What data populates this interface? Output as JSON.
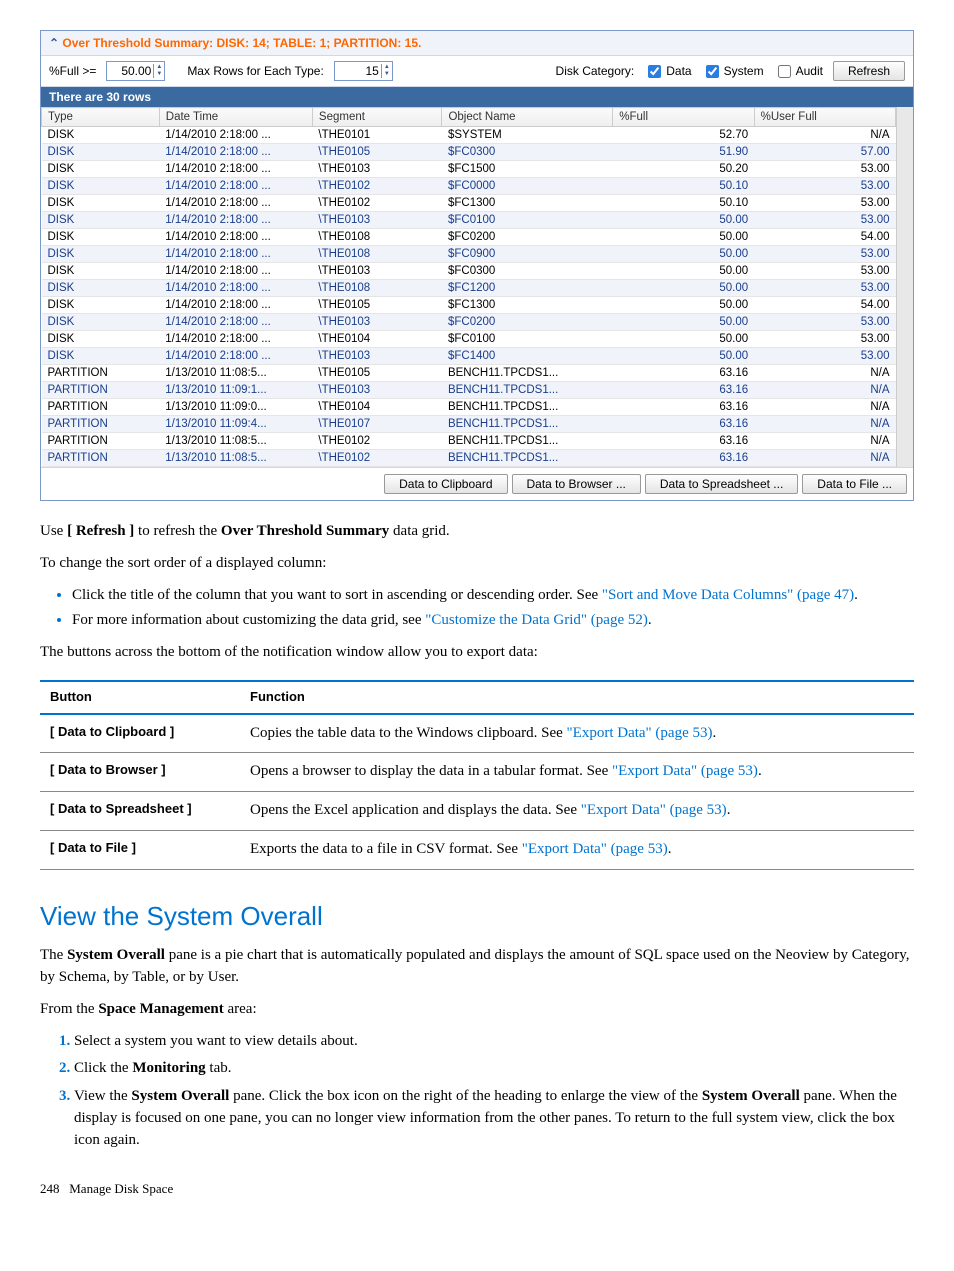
{
  "panel": {
    "title": "Over Threshold Summary: DISK: 14; TABLE: 1; PARTITION: 15.",
    "full_label": "%Full >=",
    "full_value": "50.00",
    "maxrows_label": "Max Rows for Each Type:",
    "maxrows_value": "15",
    "category_label": "Disk Category:",
    "cb_data": "Data",
    "cb_system": "System",
    "cb_audit": "Audit",
    "refresh": "Refresh",
    "rowcount": "There are 30 rows"
  },
  "columns": [
    "Type",
    "Date Time",
    "Segment",
    "Object Name",
    "%Full",
    "%User Full"
  ],
  "rows": [
    {
      "t": "DISK",
      "d": "1/14/2010 2:18:00 ...",
      "s": "\\THE0101",
      "o": "$SYSTEM",
      "f": "52.70",
      "u": "N/A",
      "alt": false
    },
    {
      "t": "DISK",
      "d": "1/14/2010 2:18:00 ...",
      "s": "\\THE0105",
      "o": "$FC0300",
      "f": "51.90",
      "u": "57.00",
      "alt": true
    },
    {
      "t": "DISK",
      "d": "1/14/2010 2:18:00 ...",
      "s": "\\THE0103",
      "o": "$FC1500",
      "f": "50.20",
      "u": "53.00",
      "alt": false
    },
    {
      "t": "DISK",
      "d": "1/14/2010 2:18:00 ...",
      "s": "\\THE0102",
      "o": "$FC0000",
      "f": "50.10",
      "u": "53.00",
      "alt": true
    },
    {
      "t": "DISK",
      "d": "1/14/2010 2:18:00 ...",
      "s": "\\THE0102",
      "o": "$FC1300",
      "f": "50.10",
      "u": "53.00",
      "alt": false
    },
    {
      "t": "DISK",
      "d": "1/14/2010 2:18:00 ...",
      "s": "\\THE0103",
      "o": "$FC0100",
      "f": "50.00",
      "u": "53.00",
      "alt": true
    },
    {
      "t": "DISK",
      "d": "1/14/2010 2:18:00 ...",
      "s": "\\THE0108",
      "o": "$FC0200",
      "f": "50.00",
      "u": "54.00",
      "alt": false
    },
    {
      "t": "DISK",
      "d": "1/14/2010 2:18:00 ...",
      "s": "\\THE0108",
      "o": "$FC0900",
      "f": "50.00",
      "u": "53.00",
      "alt": true
    },
    {
      "t": "DISK",
      "d": "1/14/2010 2:18:00 ...",
      "s": "\\THE0103",
      "o": "$FC0300",
      "f": "50.00",
      "u": "53.00",
      "alt": false
    },
    {
      "t": "DISK",
      "d": "1/14/2010 2:18:00 ...",
      "s": "\\THE0108",
      "o": "$FC1200",
      "f": "50.00",
      "u": "53.00",
      "alt": true
    },
    {
      "t": "DISK",
      "d": "1/14/2010 2:18:00 ...",
      "s": "\\THE0105",
      "o": "$FC1300",
      "f": "50.00",
      "u": "54.00",
      "alt": false
    },
    {
      "t": "DISK",
      "d": "1/14/2010 2:18:00 ...",
      "s": "\\THE0103",
      "o": "$FC0200",
      "f": "50.00",
      "u": "53.00",
      "alt": true
    },
    {
      "t": "DISK",
      "d": "1/14/2010 2:18:00 ...",
      "s": "\\THE0104",
      "o": "$FC0100",
      "f": "50.00",
      "u": "53.00",
      "alt": false
    },
    {
      "t": "DISK",
      "d": "1/14/2010 2:18:00 ...",
      "s": "\\THE0103",
      "o": "$FC1400",
      "f": "50.00",
      "u": "53.00",
      "alt": true
    },
    {
      "t": "PARTITION",
      "d": "1/13/2010 11:08:5...",
      "s": "\\THE0105",
      "o": "BENCH11.TPCDS1...",
      "f": "63.16",
      "u": "N/A",
      "alt": false
    },
    {
      "t": "PARTITION",
      "d": "1/13/2010 11:09:1...",
      "s": "\\THE0103",
      "o": "BENCH11.TPCDS1...",
      "f": "63.16",
      "u": "N/A",
      "alt": true
    },
    {
      "t": "PARTITION",
      "d": "1/13/2010 11:09:0...",
      "s": "\\THE0104",
      "o": "BENCH11.TPCDS1...",
      "f": "63.16",
      "u": "N/A",
      "alt": false
    },
    {
      "t": "PARTITION",
      "d": "1/13/2010 11:09:4...",
      "s": "\\THE0107",
      "o": "BENCH11.TPCDS1...",
      "f": "63.16",
      "u": "N/A",
      "alt": true
    },
    {
      "t": "PARTITION",
      "d": "1/13/2010 11:08:5...",
      "s": "\\THE0102",
      "o": "BENCH11.TPCDS1...",
      "f": "63.16",
      "u": "N/A",
      "alt": false
    },
    {
      "t": "PARTITION",
      "d": "1/13/2010 11:08:5...",
      "s": "\\THE0102",
      "o": "BENCH11.TPCDS1...",
      "f": "63.16",
      "u": "N/A",
      "alt": true
    }
  ],
  "buttons": {
    "clip": "Data to Clipboard",
    "browser": "Data to Browser ...",
    "spread": "Data to Spreadsheet ...",
    "file": "Data to File ..."
  },
  "body": {
    "p1a": "Use ",
    "p1b": "[ Refresh ]",
    "p1c": " to refresh the ",
    "p1d": "Over Threshold Summary",
    "p1e": " data grid.",
    "p2": "To change the sort order of a displayed column:",
    "li1a": "Click the title of the column that you want to sort in ascending or descending order. See ",
    "li1b": "\"Sort and Move Data Columns\" (page 47)",
    "li1c": ".",
    "li2a": "For more information about customizing the data grid, see ",
    "li2b": "\"Customize the Data Grid\" (page 52)",
    "li2c": ".",
    "p3": "The buttons across the bottom of the notification window allow you to export data:"
  },
  "table": {
    "h1": "Button",
    "h2": "Function",
    "r1a": "[ Data to Clipboard ]",
    "r1b": "Copies the table data to the Windows clipboard. See ",
    "r1c": "\"Export Data\" (page 53)",
    "r1d": ".",
    "r2a": "[ Data to Browser ]",
    "r2b": "Opens a browser to display the data in a tabular format. See ",
    "r2c": "\"Export Data\" (page 53)",
    "r2d": ".",
    "r3a": "[ Data to Spreadsheet ]",
    "r3b": "Opens the Excel application and displays the data. See ",
    "r3c": "\"Export Data\" (page 53)",
    "r3d": ".",
    "r4a": "[ Data to File ]",
    "r4b": "Exports the data to a file in CSV format. See ",
    "r4c": "\"Export Data\" (page 53)",
    "r4d": "."
  },
  "section_title": "View the System Overall",
  "sec": {
    "p1a": "The ",
    "p1b": "System Overall",
    "p1c": " pane is a pie chart that is automatically populated and displays the amount of SQL space used on the Neoview by Category, by Schema, by Table, or by User.",
    "p2a": "From the ",
    "p2b": "Space Management",
    "p2c": " area:",
    "o1": "Select a system you want to view details about.",
    "o2a": "Click the ",
    "o2b": "Monitoring",
    "o2c": " tab.",
    "o3a": "View the ",
    "o3b": "System Overall",
    "o3c": " pane. Click the box icon on the right of the heading to enlarge the view of the ",
    "o3d": "System Overall",
    "o3e": " pane. When the display is focused on one pane, you can no longer view information from the other panes. To return to the full system view, click the box icon again."
  },
  "footer": {
    "page": "248",
    "title": "Manage Disk Space"
  }
}
